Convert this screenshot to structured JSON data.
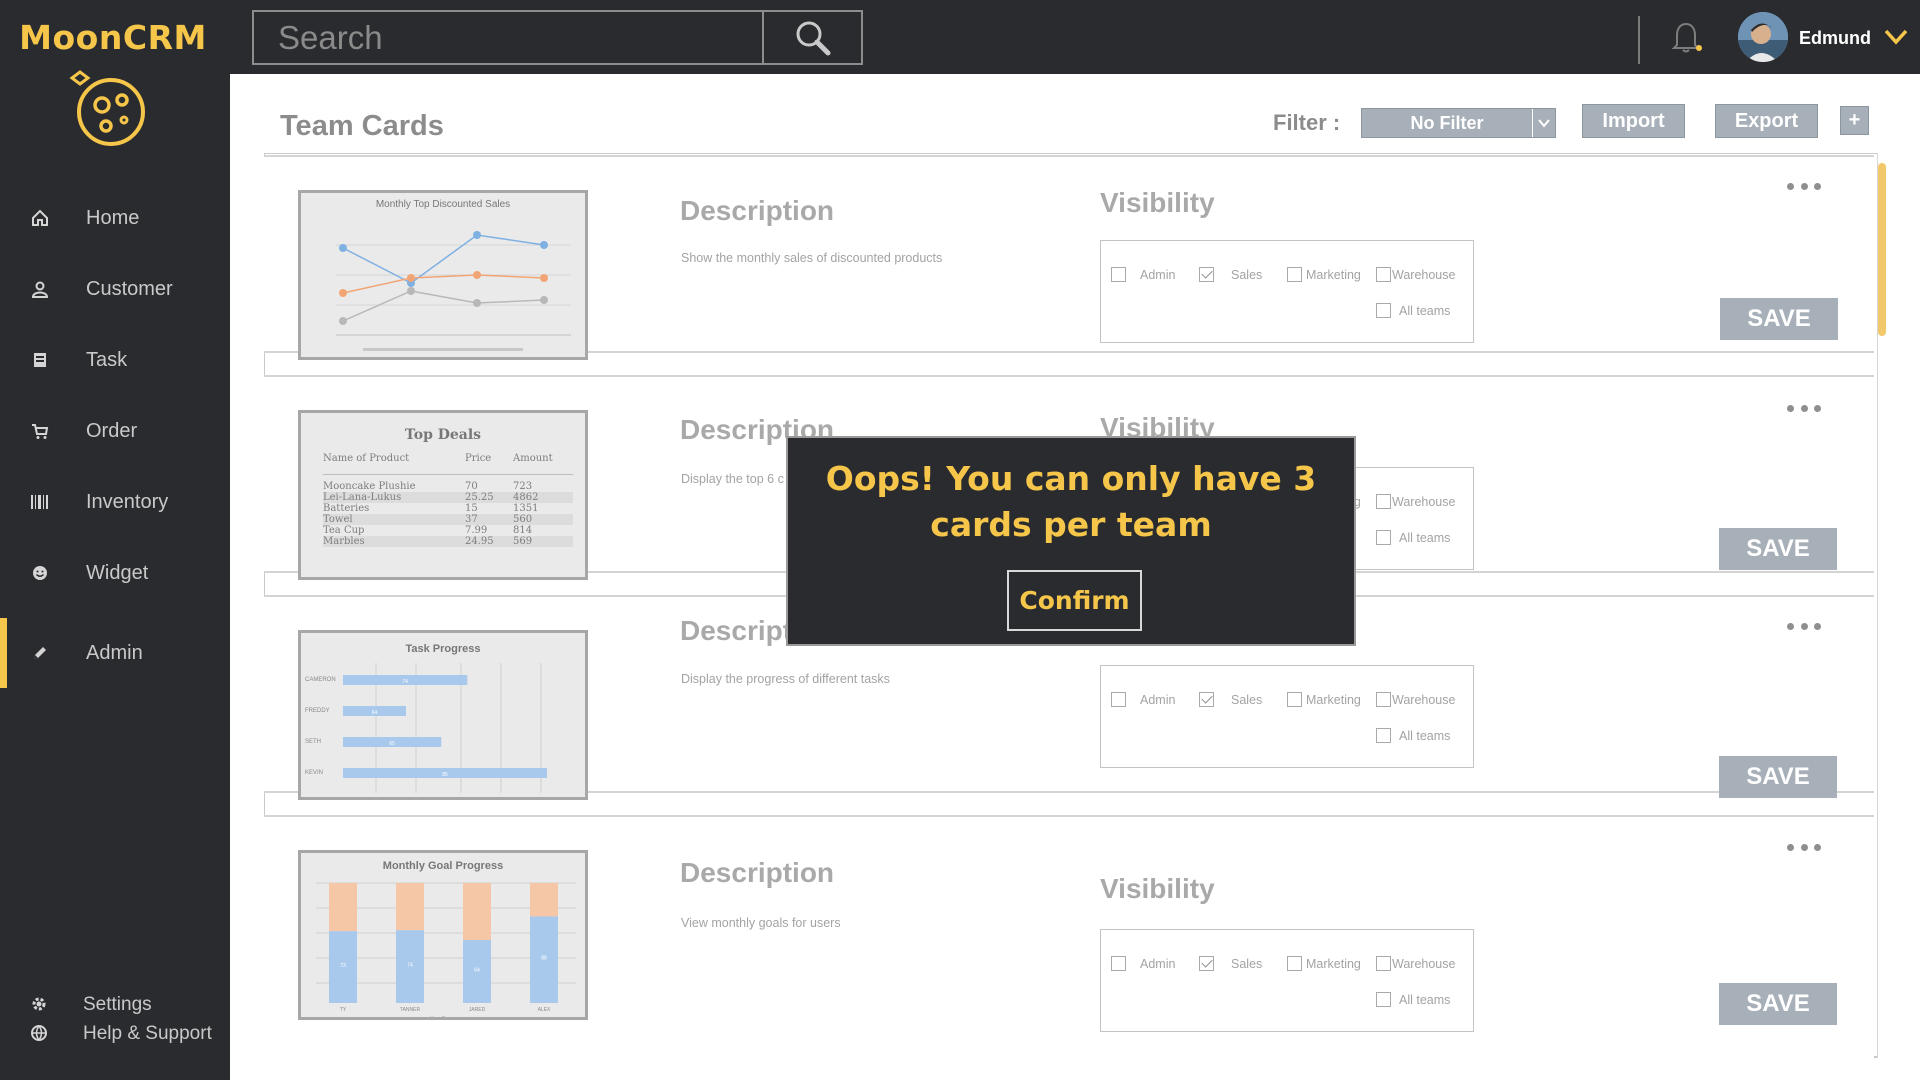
{
  "app": {
    "name": "MoonCRM"
  },
  "sidebar": {
    "items": [
      {
        "label": "Home",
        "icon": "home-icon"
      },
      {
        "label": "Customer",
        "icon": "user-icon"
      },
      {
        "label": "Task",
        "icon": "task-icon"
      },
      {
        "label": "Order",
        "icon": "cart-icon"
      },
      {
        "label": "Inventory",
        "icon": "barcode-icon"
      },
      {
        "label": "Widget",
        "icon": "smiley-icon"
      },
      {
        "label": "Admin",
        "icon": "pencil-icon",
        "active": true
      }
    ],
    "bottom": [
      {
        "label": "Settings",
        "icon": "gear-icon"
      },
      {
        "label": "Help & Support",
        "icon": "globe-icon"
      }
    ]
  },
  "topbar": {
    "search_placeholder": "Search",
    "username": "Edmund"
  },
  "header": {
    "title": "Team Cards",
    "filter_label": "Filter :",
    "filter_value": "No Filter",
    "import_label": "Import",
    "export_label": "Export",
    "add_label": "+"
  },
  "labels": {
    "description": "Description",
    "visibility": "Visibility",
    "save": "SAVE",
    "teams": [
      "Admin",
      "Sales",
      "Marketing",
      "Warehouse",
      "All teams"
    ]
  },
  "cards": [
    {
      "thumbnail_title": "Monthly Top Discounted Sales",
      "description_text": "Show the monthly sales of discounted products",
      "checked": [
        false,
        true,
        false,
        false,
        false
      ]
    },
    {
      "thumbnail_title": "Top Deals",
      "description_text": "Display the top 6 c",
      "checked": [
        false,
        true,
        false,
        false,
        false
      ],
      "table": {
        "headers": [
          "Name of Product",
          "Price",
          "Amount"
        ],
        "rows": [
          [
            "Mooncake Plushie",
            "70",
            "723"
          ],
          [
            "Lei-Lana-Lukus",
            "25.25",
            "4862"
          ],
          [
            "Batteries",
            "15",
            "1351"
          ],
          [
            "Towel",
            "37",
            "560"
          ],
          [
            "Tea Cup",
            "7.99",
            "814"
          ],
          [
            "Marbles",
            "24.95",
            "569"
          ]
        ]
      }
    },
    {
      "thumbnail_title": "Task Progress",
      "description_text": "Display the progress of different  tasks",
      "checked": [
        false,
        true,
        false,
        false,
        false
      ],
      "chart": {
        "categories": [
          "CAMERON",
          "FREDDY",
          "SETH",
          "KEVIN"
        ],
        "values": [
          74,
          64,
          65,
          85
        ]
      }
    },
    {
      "thumbnail_title": "Monthly Goal Progress",
      "description_text": "View monthly goals for users",
      "checked": [
        false,
        true,
        false,
        false,
        false
      ],
      "chart": {
        "categories": [
          "TY",
          "TANNER",
          "JARED",
          "ALEX"
        ],
        "values": [
          73,
          74,
          64,
          88
        ],
        "legend": "User Progress"
      }
    }
  ],
  "modal": {
    "line1": "Oops! You can only have 3",
    "line2": "cards per team",
    "confirm_label": "Confirm"
  },
  "colors": {
    "sidebar_bg": "#2a2b2f",
    "accent": "#f5c64a",
    "button_grey": "#a7b0b8"
  }
}
